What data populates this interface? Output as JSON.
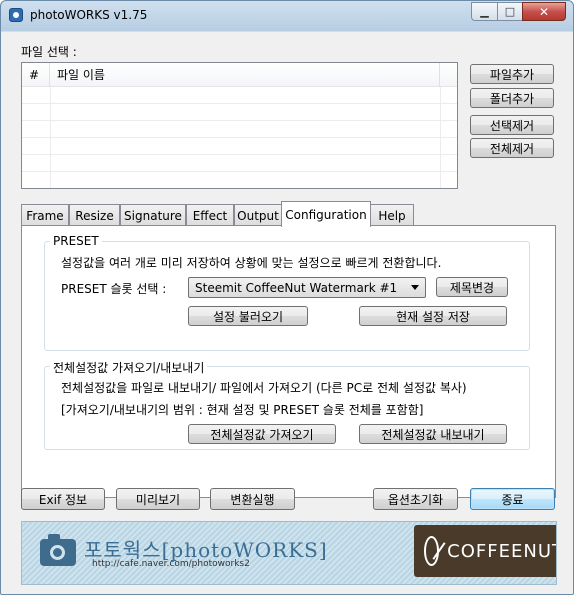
{
  "window": {
    "title": "photoWORKS v1.75",
    "controls": {
      "minimize": "▁",
      "maximize": "□",
      "close": "✕"
    }
  },
  "file_select": {
    "label": "파일 선택 :",
    "columns": [
      "#",
      "파일 이름"
    ]
  },
  "file_buttons": {
    "add_file": "파일추가",
    "add_folder": "폴더추가",
    "remove_selected": "선택제거",
    "remove_all": "전체제거"
  },
  "tabs": [
    {
      "label": "Frame"
    },
    {
      "label": "Resize"
    },
    {
      "label": "Signature"
    },
    {
      "label": "Effect"
    },
    {
      "label": "Output"
    },
    {
      "label": "Configuration",
      "active": true
    },
    {
      "label": "Help"
    }
  ],
  "preset": {
    "group_title": "PRESET",
    "description": "설정값을 여러 개로 미리 저장하여 상황에 맞는 설정으로 빠르게 전환합니다.",
    "slot_label": "PRESET 슬롯 선택 :",
    "slot_value": "Steemit CoffeeNut Watermark #1",
    "rename_button": "제목변경",
    "load_button": "설정 불러오기",
    "save_button": "현재 설정 저장"
  },
  "import_export": {
    "group_title": "전체설정값 가져오기/내보내기",
    "line1": "전체설정값을 파일로 내보내기/ 파일에서 가져오기 (다른 PC로 전체 설정값 복사)",
    "line2": "[가져오기/내보내기의 범위 : 현재 설정 및 PRESET 슬롯 전체를 포함함]",
    "import_button": "전체설정값 가져오기",
    "export_button": "전체설정값 내보내기"
  },
  "bottom_buttons": {
    "exif": "Exif 정보",
    "preview": "미리보기",
    "convert": "변환실행",
    "reset_options": "옵션초기화",
    "exit": "종료"
  },
  "banner": {
    "brand": "포토웍스[photoWORKS]",
    "url": "http://cafe.naver.com/photoworks2",
    "partner": "COFFEENUT"
  }
}
